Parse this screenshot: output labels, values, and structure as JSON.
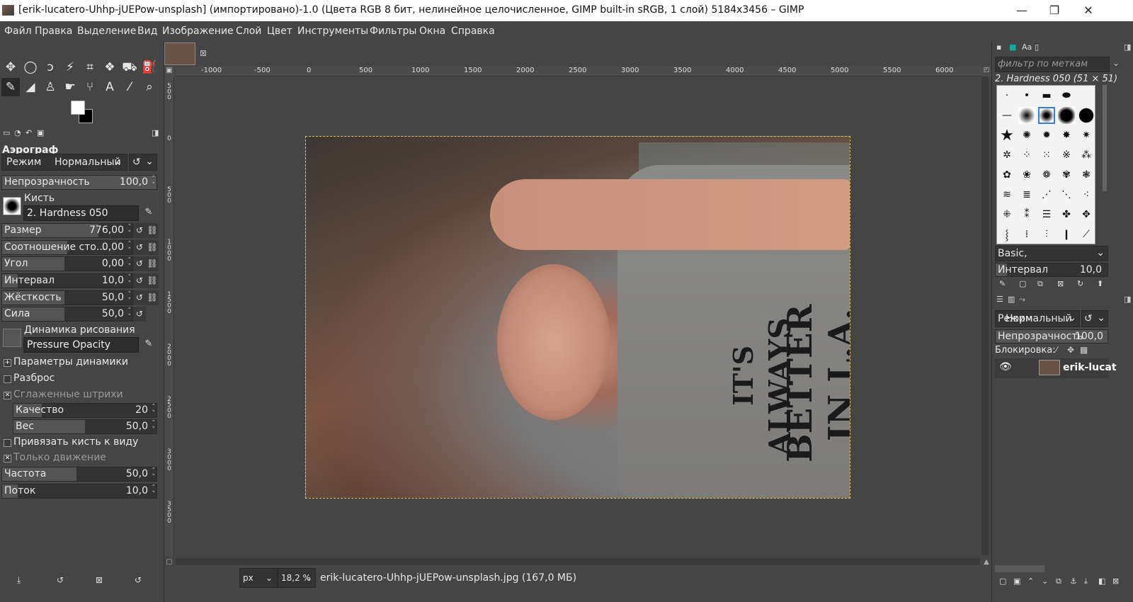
{
  "window": {
    "title": "[erik-lucatero-Uhhp-jUEPow-unsplash] (импортировано)-1.0 (Цвета RGB 8 бит, нелинейное целочисленное, GIMP built-in sRGB, 1 слой) 5184x3456 – GIMP",
    "minimize": "—",
    "maximize": "❐",
    "close": "✕"
  },
  "menu": [
    "Файл",
    "Правка",
    "Выделение",
    "Вид",
    "Изображение",
    "Слой",
    "Цвет",
    "Инструменты",
    "Фильтры",
    "Окна",
    "Справка"
  ],
  "tools": [
    {
      "name": "move-tool-icon",
      "glyph": "✥"
    },
    {
      "name": "ellipse-select-icon",
      "glyph": "◯"
    },
    {
      "name": "free-select-icon",
      "glyph": "ↄ"
    },
    {
      "name": "fuzzy-select-icon",
      "glyph": "⚡"
    },
    {
      "name": "crop-tool-icon",
      "glyph": "⌗"
    },
    {
      "name": "transform-tool-icon",
      "glyph": "❖"
    },
    {
      "name": "warp-tool-icon",
      "glyph": "⛟"
    },
    {
      "name": "bucket-fill-icon",
      "glyph": "⛽"
    },
    {
      "name": "airbrush-tool-icon",
      "glyph": "✎",
      "active": true
    },
    {
      "name": "eraser-tool-icon",
      "glyph": "◢"
    },
    {
      "name": "clone-tool-icon",
      "glyph": "♙"
    },
    {
      "name": "smudge-tool-icon",
      "glyph": "☛"
    },
    {
      "name": "paths-tool-icon",
      "glyph": "⑂"
    },
    {
      "name": "text-tool-icon",
      "glyph": "A"
    },
    {
      "name": "color-picker-icon",
      "glyph": "⁄"
    },
    {
      "name": "zoom-tool-icon",
      "glyph": "🔍"
    }
  ],
  "options": {
    "title": "Аэрограф",
    "mode_label": "Режим",
    "mode_value": "Нормальный",
    "opacity": {
      "label": "Непрозрачность",
      "value": "100,0",
      "fraction": 1.0
    },
    "brush_label": "Кисть",
    "brush_value": "2. Hardness 050",
    "size": {
      "label": "Размер",
      "value": "776,00",
      "fraction": 0.74
    },
    "ratio": {
      "label": "Соотношение сто...",
      "value": "0,00",
      "fraction": 0.5
    },
    "angle": {
      "label": "Угол",
      "value": "0,00",
      "fraction": 0.5
    },
    "spacing": {
      "label": "Интервал",
      "value": "10,0",
      "fraction": 0.1
    },
    "hardness": {
      "label": "Жёсткость",
      "value": "50,0",
      "fraction": 0.5
    },
    "force": {
      "label": "Сила",
      "value": "50,0",
      "fraction": 0.5
    },
    "dynamics_label": "Динамика рисования",
    "dynamics_value": "Pressure Opacity",
    "dyn_params": "Параметры динамики",
    "jitter": "Разброс",
    "smooth": "Сглаженные штрихи",
    "quality": {
      "label": "Качество",
      "value": "20",
      "fraction": 0.2
    },
    "weight": {
      "label": "Вес",
      "value": "50,0",
      "fraction": 0.5
    },
    "lock_brush": "Привязать кисть к виду",
    "motion_only": "Только движение",
    "rate": {
      "label": "Частота",
      "value": "50,0",
      "fraction": 0.5
    },
    "flow": {
      "label": "Поток",
      "value": "10,0",
      "fraction": 0.1
    }
  },
  "ruler_h": [
    "-1000",
    "-500",
    "0",
    "500",
    "1000",
    "1500",
    "2000",
    "2500",
    "3000",
    "3500",
    "4000",
    "4500",
    "5000",
    "5500",
    "6000"
  ],
  "ruler_v": [
    "5\n0\n0",
    "0",
    "5\n0\n0",
    "1\n0\n0\n0",
    "1\n5\n0\n0",
    "2\n0\n0\n0",
    "2\n5\n0\n0",
    "3\n0\n0\n0",
    "3\n5\n0\n0"
  ],
  "image": {
    "shirt_line1": "IT'S",
    "shirt_line2": "ALWAYS",
    "shirt_line3": "BETTER",
    "shirt_line4": "IN L.A."
  },
  "status": {
    "unit": "px",
    "zoom": "18,2 %",
    "file": "erik-lucatero-Uhhp-jUEPow-unsplash.jpg (167,0 МБ)"
  },
  "brushes": {
    "filter_placeholder": "фильтр по меткам",
    "current": "2. Hardness 050 (51 × 51)",
    "preset": "Basic,",
    "spacing": {
      "label": "Интервал",
      "value": "10,0"
    }
  },
  "layers": {
    "mode_label": "Режим",
    "mode_value": "Нормальный",
    "opacity": {
      "label": "Непрозрачность",
      "value": "100,0"
    },
    "lock_label": "Блокировка:",
    "layer_name": "erik-lucat"
  }
}
